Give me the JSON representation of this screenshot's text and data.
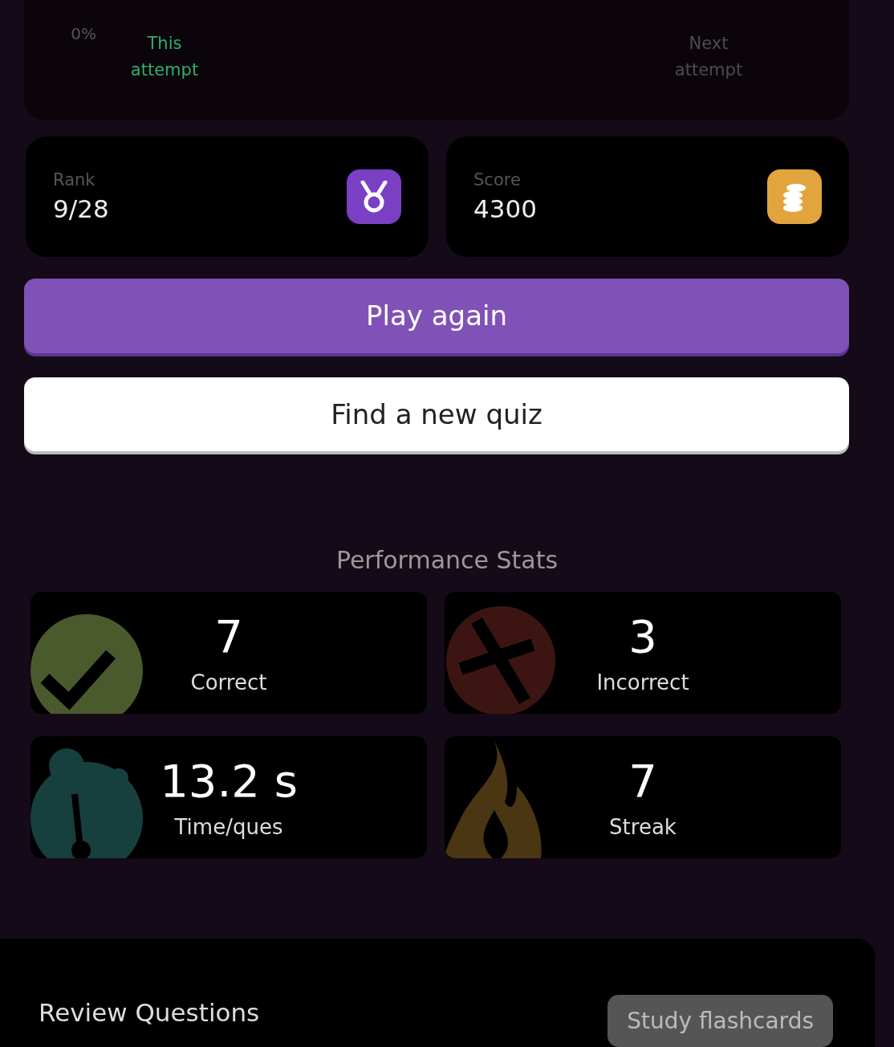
{
  "attempt_chart": {
    "tick": "0%",
    "labels": [
      {
        "text": "This attempt",
        "current": true
      },
      {
        "text": "Next attempt",
        "current": false
      }
    ]
  },
  "summary": [
    {
      "label": "Rank",
      "value": "9/28",
      "kind": "medal",
      "color": "#7b3fc4"
    },
    {
      "label": "Score",
      "value": "4300",
      "kind": "coins",
      "color": "#e2a43c"
    }
  ],
  "buttons": [
    {
      "label": "Play again",
      "kind": "primary"
    },
    {
      "label": "Find a new quiz",
      "kind": "secondary"
    }
  ],
  "stats_title": "Performance Stats",
  "stats": [
    {
      "value": "7",
      "label": "Correct",
      "kind": "check"
    },
    {
      "value": "3",
      "label": "Incorrect",
      "kind": "cross"
    },
    {
      "value": "13.2 s",
      "label": "Time/ques",
      "kind": "timer"
    },
    {
      "value": "7",
      "label": "Streak",
      "kind": "flame"
    }
  ],
  "review": {
    "title": "Review Questions",
    "button": "Study flashcards"
  }
}
